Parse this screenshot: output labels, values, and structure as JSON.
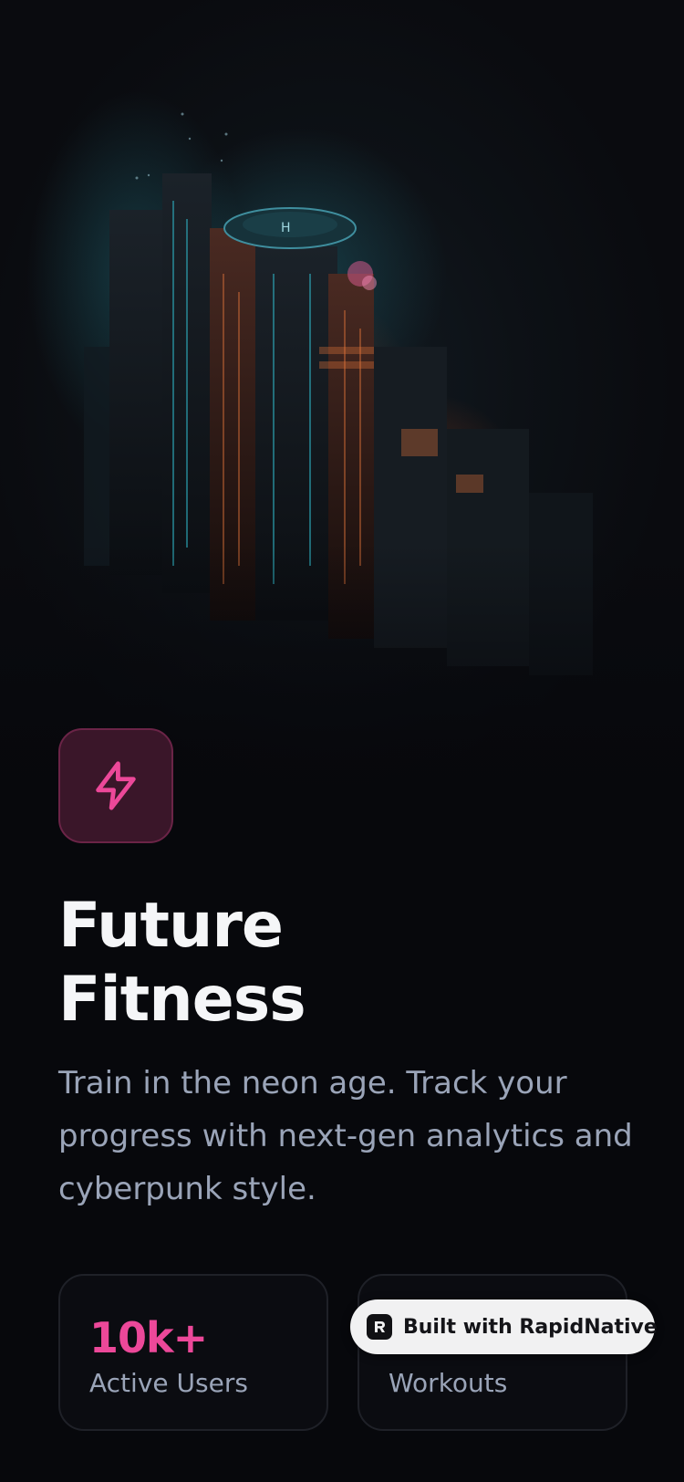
{
  "app": {
    "title": "Future Fitness",
    "title_lines": [
      "Future",
      "Fitness"
    ],
    "subtitle": "Train in the neon age. Track your progress with next-gen analytics and cyberpunk style.",
    "logo_icon": "lightning-bolt-icon",
    "hero_image": "cyberpunk-city-illustration"
  },
  "stats": [
    {
      "value": "10k+",
      "label": "Active Users"
    },
    {
      "value": "",
      "label": "Workouts"
    }
  ],
  "badge": {
    "label": "Built with RapidNative",
    "icon": "rapidnative-logo-icon"
  },
  "colors": {
    "background": "#07080c",
    "accent": "#ec4899",
    "badge_bg": "#3a1629",
    "badge_border": "#6b2447",
    "text_primary": "#f5f6f8",
    "text_secondary": "#9aa4b8",
    "card_border": "#1f2128"
  }
}
